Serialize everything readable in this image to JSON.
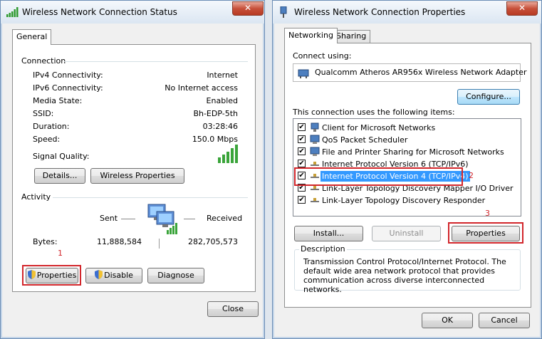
{
  "status_window": {
    "title": "Wireless Network Connection Status",
    "tab_general": "General",
    "connection_header": "Connection",
    "rows": [
      {
        "label": "IPv4 Connectivity:",
        "value": "Internet"
      },
      {
        "label": "IPv6 Connectivity:",
        "value": "No Internet access"
      },
      {
        "label": "Media State:",
        "value": "Enabled"
      },
      {
        "label": "SSID:",
        "value": "Bh-EDP-5th"
      },
      {
        "label": "Duration:",
        "value": "03:28:46"
      },
      {
        "label": "Speed:",
        "value": "150.0 Mbps"
      }
    ],
    "signal_label": "Signal Quality:",
    "signal_bars": 5,
    "details_button": "Details...",
    "wireless_properties_button": "Wireless Properties",
    "activity_header": "Activity",
    "sent_label": "Sent",
    "received_label": "Received",
    "bytes_label": "Bytes:",
    "bytes_sent": "11,888,584",
    "bytes_received": "282,705,573",
    "properties_button": "Properties",
    "disable_button": "Disable",
    "diagnose_button": "Diagnose",
    "close_button": "Close",
    "step_number": "1"
  },
  "properties_window": {
    "title": "Wireless Network Connection Properties",
    "tab_networking": "Networking",
    "tab_sharing": "Sharing",
    "connect_using_label": "Connect using:",
    "adapter_name": "Qualcomm Atheros AR956x Wireless Network Adapter",
    "configure_button": "Configure...",
    "items_label": "This connection uses the following items:",
    "items": [
      {
        "label": "Client for Microsoft Networks",
        "checked": true,
        "icon": "network-client-icon"
      },
      {
        "label": "QoS Packet Scheduler",
        "checked": true,
        "icon": "network-service-icon"
      },
      {
        "label": "File and Printer Sharing for Microsoft Networks",
        "checked": true,
        "icon": "network-service-icon"
      },
      {
        "label": "Internet Protocol Version 6 (TCP/IPv6)",
        "checked": true,
        "icon": "protocol-icon"
      },
      {
        "label": "Internet Protocol Version 4 (TCP/IPv4)",
        "checked": true,
        "icon": "protocol-icon"
      },
      {
        "label": "Link-Layer Topology Discovery Mapper I/O Driver",
        "checked": true,
        "icon": "protocol-icon"
      },
      {
        "label": "Link-Layer Topology Discovery Responder",
        "checked": true,
        "icon": "protocol-icon"
      }
    ],
    "install_button": "Install...",
    "uninstall_button": "Uninstall",
    "properties_button": "Properties",
    "description_header": "Description",
    "description_text": "Transmission Control Protocol/Internet Protocol. The default wide area network protocol that provides communication across diverse interconnected networks.",
    "ok_button": "OK",
    "cancel_button": "Cancel",
    "step_number_2": "2",
    "step_number_3": "3"
  },
  "colors": {
    "highlight": "#d2262b",
    "selection": "#3399ff"
  }
}
